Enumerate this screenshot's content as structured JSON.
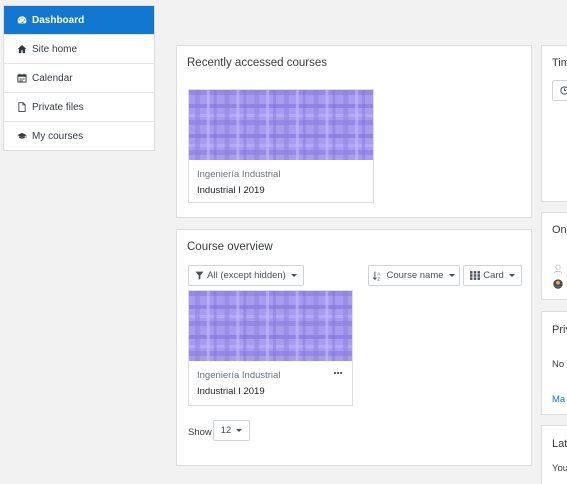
{
  "nav": {
    "items": [
      {
        "label": "Dashboard",
        "icon": "dashboard-icon"
      },
      {
        "label": "Site home",
        "icon": "home-icon"
      },
      {
        "label": "Calendar",
        "icon": "calendar-icon"
      },
      {
        "label": "Private files",
        "icon": "file-icon"
      },
      {
        "label": "My courses",
        "icon": "graduation-cap-icon"
      }
    ]
  },
  "recent": {
    "title": "Recently accessed courses",
    "course": {
      "category": "Ingeniería Industrial",
      "name": "Industrial I 2019"
    }
  },
  "overview": {
    "title": "Course overview",
    "filter_label": "All (except hidden)",
    "sort_label": "Course name",
    "view_label": "Card",
    "course": {
      "category": "Ingeniería Industrial",
      "name": "Industrial I 2019"
    },
    "show_label": "Show",
    "show_value": "12"
  },
  "side": {
    "timeline_title": "Tim",
    "online_title": "On",
    "private_title": "Priv",
    "private_text": "No",
    "private_link": "Ma",
    "latest_title": "Lat",
    "latest_text": "You"
  },
  "colors": {
    "accent": "#1177d1",
    "pattern": "#a89cf0"
  }
}
